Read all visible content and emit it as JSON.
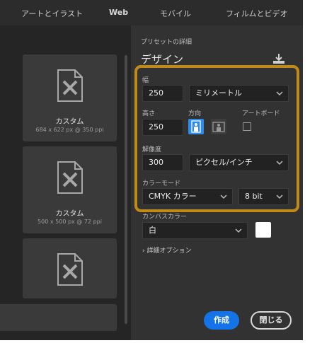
{
  "tabs": [
    "アートとイラスト",
    "Web",
    "モバイル",
    "フィルムとビデオ"
  ],
  "presets": [
    {
      "title": "カスタム",
      "subtitle": "684 x 622 px @ 350 ppi"
    },
    {
      "title": "カスタム",
      "subtitle": "500 x 500 px @ 72 ppi"
    }
  ],
  "details": {
    "section_label": "プリセットの詳細",
    "title": "デザイン",
    "width_label": "幅",
    "width_value": "250",
    "width_unit": "ミリメートル",
    "height_label": "高さ",
    "height_value": "250",
    "orientation_label": "方向",
    "artboard_label": "アートボード",
    "resolution_label": "解像度",
    "resolution_value": "300",
    "resolution_unit": "ピクセル/インチ",
    "color_mode_label": "カラーモード",
    "color_mode_value": "CMYK カラー",
    "bit_depth_value": "8 bit",
    "canvas_color_label": "カンバスカラー",
    "canvas_color_value": "白",
    "canvas_swatch": "#ffffff",
    "advanced_label": "詳細オプション"
  },
  "actions": {
    "create_label": "作成",
    "close_label": "閉じる"
  },
  "colors": {
    "accent": "#1473e6",
    "highlight": "#c08a16",
    "orientation_active": "#2d8ceb"
  }
}
